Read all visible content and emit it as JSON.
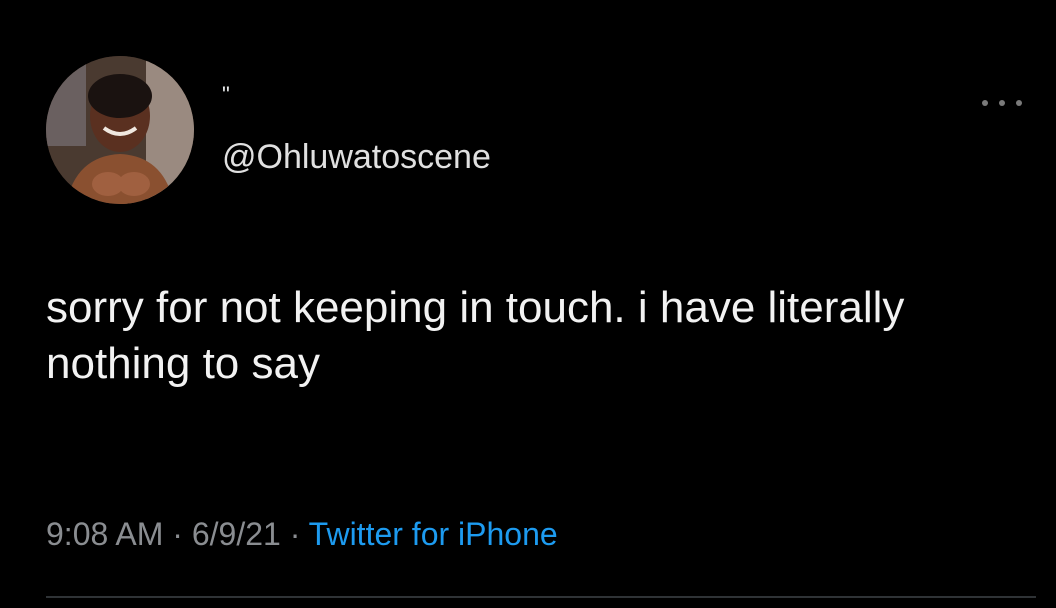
{
  "tweet": {
    "display_name": "\"",
    "handle": "@Ohluwatoscene",
    "text": "sorry for not keeping in touch. i have literally nothing to say",
    "time": "9:08 AM",
    "separator": " · ",
    "date": "6/9/21",
    "source": "Twitter for iPhone",
    "more_icon": "more-horizontal-icon"
  },
  "colors": {
    "background": "#000000",
    "text": "#f2f2f2",
    "meta": "#8a8d91",
    "link": "#1d9bf0"
  }
}
